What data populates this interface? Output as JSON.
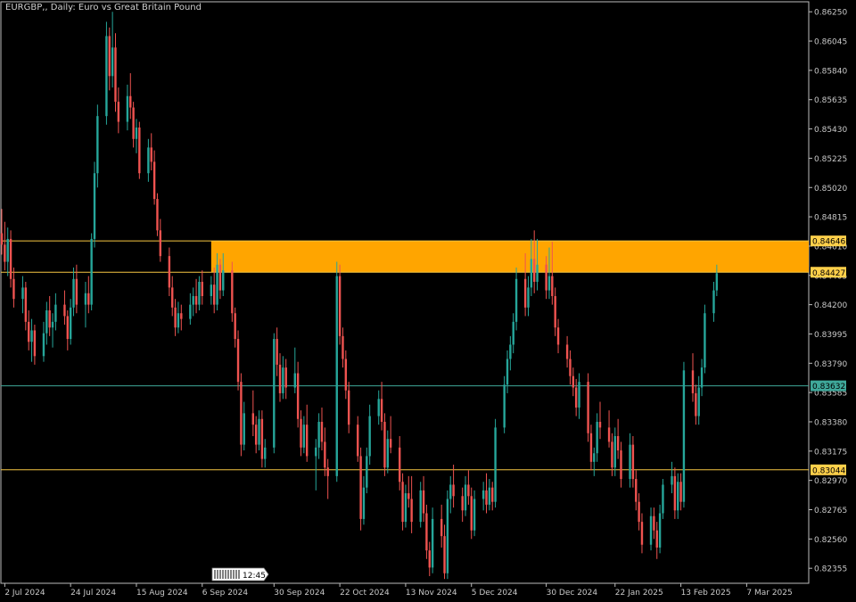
{
  "chart_data": {
    "type": "candlestick",
    "title": "EURGBP,, Daily:  Euro vs Great Britain Pound",
    "ylim": [
      0.8225,
      0.8632
    ],
    "y_ticks": [
      "0.86250",
      "0.86045",
      "0.85840",
      "0.85635",
      "0.85430",
      "0.85225",
      "0.85020",
      "0.84815",
      "0.84610",
      "0.84405",
      "0.84200",
      "0.83995",
      "0.83790",
      "0.83585",
      "0.83380",
      "0.83175",
      "0.82970",
      "0.82765",
      "0.82560",
      "0.82355"
    ],
    "x_ticks": [
      {
        "label": "2 Jul 2024",
        "day": 1
      },
      {
        "label": "24 Jul 2024",
        "day": 23
      },
      {
        "label": "15 Aug 2024",
        "day": 45
      },
      {
        "label": "6 Sep 2024",
        "day": 67
      },
      {
        "label": "30 Sep 2024",
        "day": 91
      },
      {
        "label": "22 Oct 2024",
        "day": 113
      },
      {
        "label": "13 Nov 2024",
        "day": 135
      },
      {
        "label": "5 Dec 2024",
        "day": 157
      },
      {
        "label": "30 Dec 2024",
        "day": 182
      },
      {
        "label": "22 Jan 2025",
        "day": 205
      },
      {
        "label": "13 Feb 2025",
        "day": 227
      },
      {
        "label": "7 Mar 2025",
        "day": 249
      }
    ],
    "zone": {
      "from_day": 70,
      "top": 0.84646,
      "bottom": 0.84427,
      "color": "#FFA500"
    },
    "levels": [
      {
        "value": "0.84646",
        "color": "#F5C542",
        "label_bg": "#FFD04A"
      },
      {
        "value": "0.84427",
        "color": "#F5C542",
        "label_bg": "#FFD04A"
      },
      {
        "value": "0.83632",
        "color": "#3FA89A",
        "label_bg": "#3FA89A"
      },
      {
        "value": "0.83044",
        "color": "#F5C542",
        "label_bg": "#FFD04A"
      }
    ],
    "timer_label": "12:45",
    "series": [
      {
        "points": [
          [
            0.847,
            0.8487,
            0.8455,
            0.8462
          ],
          [
            0.8462,
            0.8478,
            0.8444,
            0.845
          ],
          [
            0.845,
            0.8474,
            0.844,
            0.8466
          ],
          [
            0.8466,
            0.8472,
            0.8432,
            0.8438
          ],
          [
            0.8438,
            0.8446,
            0.8418,
            0.8424
          ],
          [
            0.8424,
            0.844,
            0.8414,
            0.8432
          ],
          [
            0.8432,
            0.8436,
            0.8402,
            0.8408
          ],
          [
            0.8408,
            0.8416,
            0.8388,
            0.8394
          ],
          [
            0.8394,
            0.841,
            0.838,
            0.8402
          ],
          [
            0.8402,
            0.8406,
            0.8378,
            0.8384
          ],
          [
            0.8384,
            0.8408,
            0.838,
            0.84
          ],
          [
            0.84,
            0.8422,
            0.8392,
            0.8416
          ],
          [
            0.8416,
            0.8426,
            0.8398,
            0.8404
          ],
          [
            0.8404,
            0.8414,
            0.839,
            0.8408
          ],
          [
            0.8408,
            0.8428,
            0.8402,
            0.842
          ],
          [
            0.842,
            0.843,
            0.8406,
            0.8412
          ],
          [
            0.8412,
            0.8416,
            0.8388,
            0.8396
          ],
          [
            0.8396,
            0.8424,
            0.8392,
            0.8418
          ],
          [
            0.8418,
            0.8446,
            0.8412,
            0.8438
          ],
          [
            0.8438,
            0.8448,
            0.8414,
            0.842
          ],
          [
            0.842,
            0.8436,
            0.8404,
            0.8428
          ],
          [
            0.8428,
            0.844,
            0.8414,
            0.842
          ],
          [
            0.842,
            0.847,
            0.8416,
            0.8466
          ],
          [
            0.8466,
            0.852,
            0.846,
            0.8512
          ],
          [
            0.8512,
            0.856,
            0.8502,
            0.8552
          ],
          [
            0.8552,
            0.8618,
            0.8546,
            0.8608
          ],
          [
            0.8608,
            0.8614,
            0.857,
            0.858
          ],
          [
            0.858,
            0.8625,
            0.8572,
            0.86
          ],
          [
            0.86,
            0.861,
            0.8555,
            0.8562
          ],
          [
            0.8562,
            0.8572,
            0.854,
            0.8548
          ],
          [
            0.8548,
            0.8574,
            0.8542,
            0.8566
          ],
          [
            0.8566,
            0.8582,
            0.855,
            0.8558
          ],
          [
            0.8558,
            0.8562,
            0.853,
            0.8536
          ],
          [
            0.8536,
            0.855,
            0.8526,
            0.8544
          ],
          [
            0.8544,
            0.8548,
            0.8508,
            0.8512
          ],
          [
            0.8512,
            0.8536,
            0.8506,
            0.853
          ],
          [
            0.853,
            0.854,
            0.8514,
            0.852
          ],
          [
            0.852,
            0.8528,
            0.849,
            0.8494
          ],
          [
            0.8494,
            0.8498,
            0.8468,
            0.8472
          ],
          [
            0.8472,
            0.848,
            0.845,
            0.8454
          ],
          [
            0.8454,
            0.846,
            0.8426,
            0.8432
          ],
          [
            0.8432,
            0.844,
            0.8412,
            0.8418
          ],
          [
            0.8418,
            0.8424,
            0.8398,
            0.8404
          ],
          [
            0.8404,
            0.8422,
            0.84,
            0.8414
          ],
          [
            0.8414,
            0.842,
            0.8402,
            0.841
          ],
          [
            0.841,
            0.8428,
            0.8406,
            0.842
          ],
          [
            0.842,
            0.8432,
            0.8412,
            0.8426
          ],
          [
            0.8426,
            0.8438,
            0.8414,
            0.842
          ],
          [
            0.842,
            0.844,
            0.8416,
            0.8436
          ],
          [
            0.8436,
            0.8444,
            0.842,
            0.8426
          ],
          [
            0.8426,
            0.844,
            0.842,
            0.8434
          ],
          [
            0.8434,
            0.8446,
            0.8414,
            0.842
          ],
          [
            0.842,
            0.8456,
            0.8416,
            0.8448
          ],
          [
            0.8448,
            0.8452,
            0.8424,
            0.843
          ],
          [
            0.843,
            0.8456,
            0.8426,
            0.8444
          ],
          [
            0.8444,
            0.845,
            0.8408,
            0.8414
          ],
          [
            0.8414,
            0.8418,
            0.839,
            0.8396
          ],
          [
            0.8396,
            0.8402,
            0.836,
            0.8366
          ],
          [
            0.8366,
            0.8372,
            0.8314,
            0.8322
          ],
          [
            0.8322,
            0.8352,
            0.8318,
            0.8344
          ],
          [
            0.8344,
            0.836,
            0.8328,
            0.8336
          ],
          [
            0.8336,
            0.8342,
            0.8316,
            0.8322
          ],
          [
            0.8322,
            0.8346,
            0.8318,
            0.834
          ],
          [
            0.834,
            0.8346,
            0.8306,
            0.8312
          ],
          [
            0.8312,
            0.8326,
            0.8306,
            0.832
          ],
          [
            0.832,
            0.84,
            0.8316,
            0.8396
          ],
          [
            0.8396,
            0.8404,
            0.837,
            0.8378
          ],
          [
            0.8378,
            0.8386,
            0.8352,
            0.8358
          ],
          [
            0.8358,
            0.8384,
            0.8354,
            0.8376
          ],
          [
            0.8376,
            0.8382,
            0.8354,
            0.8362
          ],
          [
            0.8362,
            0.839,
            0.8358,
            0.8372
          ],
          [
            0.8372,
            0.838,
            0.8334,
            0.834
          ],
          [
            0.834,
            0.8346,
            0.8314,
            0.832
          ],
          [
            0.832,
            0.8342,
            0.8316,
            0.8336
          ],
          [
            0.8336,
            0.835,
            0.831,
            0.8314
          ],
          [
            0.8314,
            0.8326,
            0.829,
            0.832
          ],
          [
            0.832,
            0.8344,
            0.8312,
            0.8338
          ],
          [
            0.8338,
            0.8348,
            0.8318,
            0.8324
          ],
          [
            0.8324,
            0.8334,
            0.83,
            0.8306
          ],
          [
            0.8306,
            0.8312,
            0.8284,
            0.83
          ],
          [
            0.83,
            0.845,
            0.8296,
            0.844
          ],
          [
            0.844,
            0.8448,
            0.8392,
            0.8398
          ],
          [
            0.8398,
            0.8404,
            0.8376,
            0.8382
          ],
          [
            0.8382,
            0.8388,
            0.8354,
            0.836
          ],
          [
            0.836,
            0.8366,
            0.833,
            0.8336
          ],
          [
            0.8336,
            0.8342,
            0.831,
            0.8314
          ],
          [
            0.8314,
            0.832,
            0.8262,
            0.827
          ],
          [
            0.827,
            0.83,
            0.8266,
            0.8292
          ],
          [
            0.8292,
            0.832,
            0.8288,
            0.8314
          ],
          [
            0.8314,
            0.835,
            0.8308,
            0.8342
          ],
          [
            0.8342,
            0.836,
            0.8336,
            0.8354
          ],
          [
            0.8354,
            0.8366,
            0.8332,
            0.8338
          ],
          [
            0.8338,
            0.8344,
            0.83,
            0.8306
          ],
          [
            0.8306,
            0.8332,
            0.8302,
            0.8326
          ],
          [
            0.8326,
            0.8342,
            0.8316,
            0.832
          ],
          [
            0.832,
            0.8328,
            0.829,
            0.8296
          ],
          [
            0.8296,
            0.8302,
            0.8262,
            0.8268
          ],
          [
            0.8268,
            0.8294,
            0.8264,
            0.8288
          ],
          [
            0.8288,
            0.83,
            0.8278,
            0.8284
          ],
          [
            0.8284,
            0.83,
            0.826,
            0.8268
          ],
          [
            0.8268,
            0.8296,
            0.8264,
            0.829
          ],
          [
            0.829,
            0.83,
            0.8268,
            0.8274
          ],
          [
            0.8274,
            0.828,
            0.8242,
            0.8248
          ],
          [
            0.8248,
            0.8254,
            0.823,
            0.8236
          ],
          [
            0.8236,
            0.8278,
            0.8232,
            0.827
          ],
          [
            0.827,
            0.828,
            0.825,
            0.8258
          ],
          [
            0.8258,
            0.8266,
            0.8228,
            0.8232
          ],
          [
            0.8232,
            0.829,
            0.8228,
            0.8284
          ],
          [
            0.8284,
            0.83,
            0.8274,
            0.8294
          ],
          [
            0.8294,
            0.8308,
            0.8278,
            0.8286
          ],
          [
            0.8286,
            0.8292,
            0.8268,
            0.8276
          ],
          [
            0.8276,
            0.83,
            0.8272,
            0.8294
          ],
          [
            0.8294,
            0.8304,
            0.828,
            0.8286
          ],
          [
            0.8286,
            0.8292,
            0.8256,
            0.8262
          ],
          [
            0.8262,
            0.829,
            0.8258,
            0.8284
          ],
          [
            0.8284,
            0.8296,
            0.8276,
            0.829
          ],
          [
            0.829,
            0.8302,
            0.8274,
            0.828
          ],
          [
            0.828,
            0.8298,
            0.8276,
            0.8292
          ],
          [
            0.8292,
            0.8296,
            0.8276,
            0.8282
          ],
          [
            0.8282,
            0.834,
            0.8278,
            0.8334
          ],
          [
            0.8334,
            0.837,
            0.833,
            0.8364
          ],
          [
            0.8364,
            0.8388,
            0.8358,
            0.8382
          ],
          [
            0.8382,
            0.8398,
            0.8374,
            0.8392
          ],
          [
            0.8392,
            0.8414,
            0.8386,
            0.8408
          ],
          [
            0.8408,
            0.8446,
            0.8402,
            0.8438
          ],
          [
            0.8438,
            0.8456,
            0.8412,
            0.8418
          ],
          [
            0.8418,
            0.844,
            0.8412,
            0.8432
          ],
          [
            0.8432,
            0.8466,
            0.8426,
            0.8452
          ],
          [
            0.8452,
            0.8472,
            0.8428,
            0.8436
          ],
          [
            0.8436,
            0.8466,
            0.843,
            0.8448
          ],
          [
            0.8448,
            0.8454,
            0.8424,
            0.843
          ],
          [
            0.843,
            0.846,
            0.8424,
            0.844
          ],
          [
            0.844,
            0.8464,
            0.842,
            0.8426
          ],
          [
            0.8426,
            0.8432,
            0.8398,
            0.8404
          ],
          [
            0.8404,
            0.841,
            0.8386,
            0.8392
          ],
          [
            0.8392,
            0.8398,
            0.8376,
            0.8382
          ],
          [
            0.8382,
            0.8388,
            0.8364,
            0.837
          ],
          [
            0.837,
            0.8376,
            0.8356,
            0.8362
          ],
          [
            0.8362,
            0.8368,
            0.8342,
            0.8348
          ],
          [
            0.8348,
            0.8372,
            0.834,
            0.8366
          ],
          [
            0.8366,
            0.8372,
            0.8324,
            0.833
          ],
          [
            0.833,
            0.8336,
            0.8304,
            0.831
          ],
          [
            0.831,
            0.832,
            0.83,
            0.8316
          ],
          [
            0.8316,
            0.8344,
            0.831,
            0.8338
          ],
          [
            0.8338,
            0.8352,
            0.8326,
            0.8334
          ],
          [
            0.8334,
            0.8346,
            0.832,
            0.8324
          ],
          [
            0.8324,
            0.833,
            0.83,
            0.8306
          ],
          [
            0.8306,
            0.8334,
            0.83,
            0.8328
          ],
          [
            0.8328,
            0.834,
            0.8312,
            0.8318
          ],
          [
            0.8318,
            0.8324,
            0.8292,
            0.8298
          ],
          [
            0.8298,
            0.833,
            0.8292,
            0.8322
          ],
          [
            0.8322,
            0.8328,
            0.8292,
            0.8298
          ],
          [
            0.8298,
            0.8304,
            0.8276,
            0.8282
          ],
          [
            0.8282,
            0.8288,
            0.8262,
            0.8268
          ],
          [
            0.8268,
            0.8274,
            0.8246,
            0.8252
          ],
          [
            0.8252,
            0.8278,
            0.8248,
            0.8272
          ],
          [
            0.8272,
            0.8278,
            0.8256,
            0.8262
          ],
          [
            0.8262,
            0.8268,
            0.8242,
            0.825
          ],
          [
            0.825,
            0.828,
            0.8246,
            0.8274
          ],
          [
            0.8274,
            0.8298,
            0.827,
            0.8294
          ],
          [
            0.8294,
            0.831,
            0.8288,
            0.83
          ],
          [
            0.83,
            0.8306,
            0.827,
            0.8276
          ],
          [
            0.8276,
            0.8302,
            0.827,
            0.8296
          ],
          [
            0.8296,
            0.8302,
            0.8276,
            0.8282
          ],
          [
            0.8282,
            0.838,
            0.8278,
            0.8374
          ],
          [
            0.8374,
            0.8386,
            0.8352,
            0.8358
          ],
          [
            0.8358,
            0.8364,
            0.8336,
            0.8342
          ],
          [
            0.8342,
            0.837,
            0.8336,
            0.8362
          ],
          [
            0.8362,
            0.8382,
            0.8356,
            0.8376
          ],
          [
            0.8376,
            0.842,
            0.8372,
            0.8414
          ],
          [
            0.8414,
            0.8436,
            0.8408,
            0.843
          ],
          [
            0.843,
            0.8448,
            0.8426,
            0.8442
          ]
        ]
      }
    ]
  }
}
